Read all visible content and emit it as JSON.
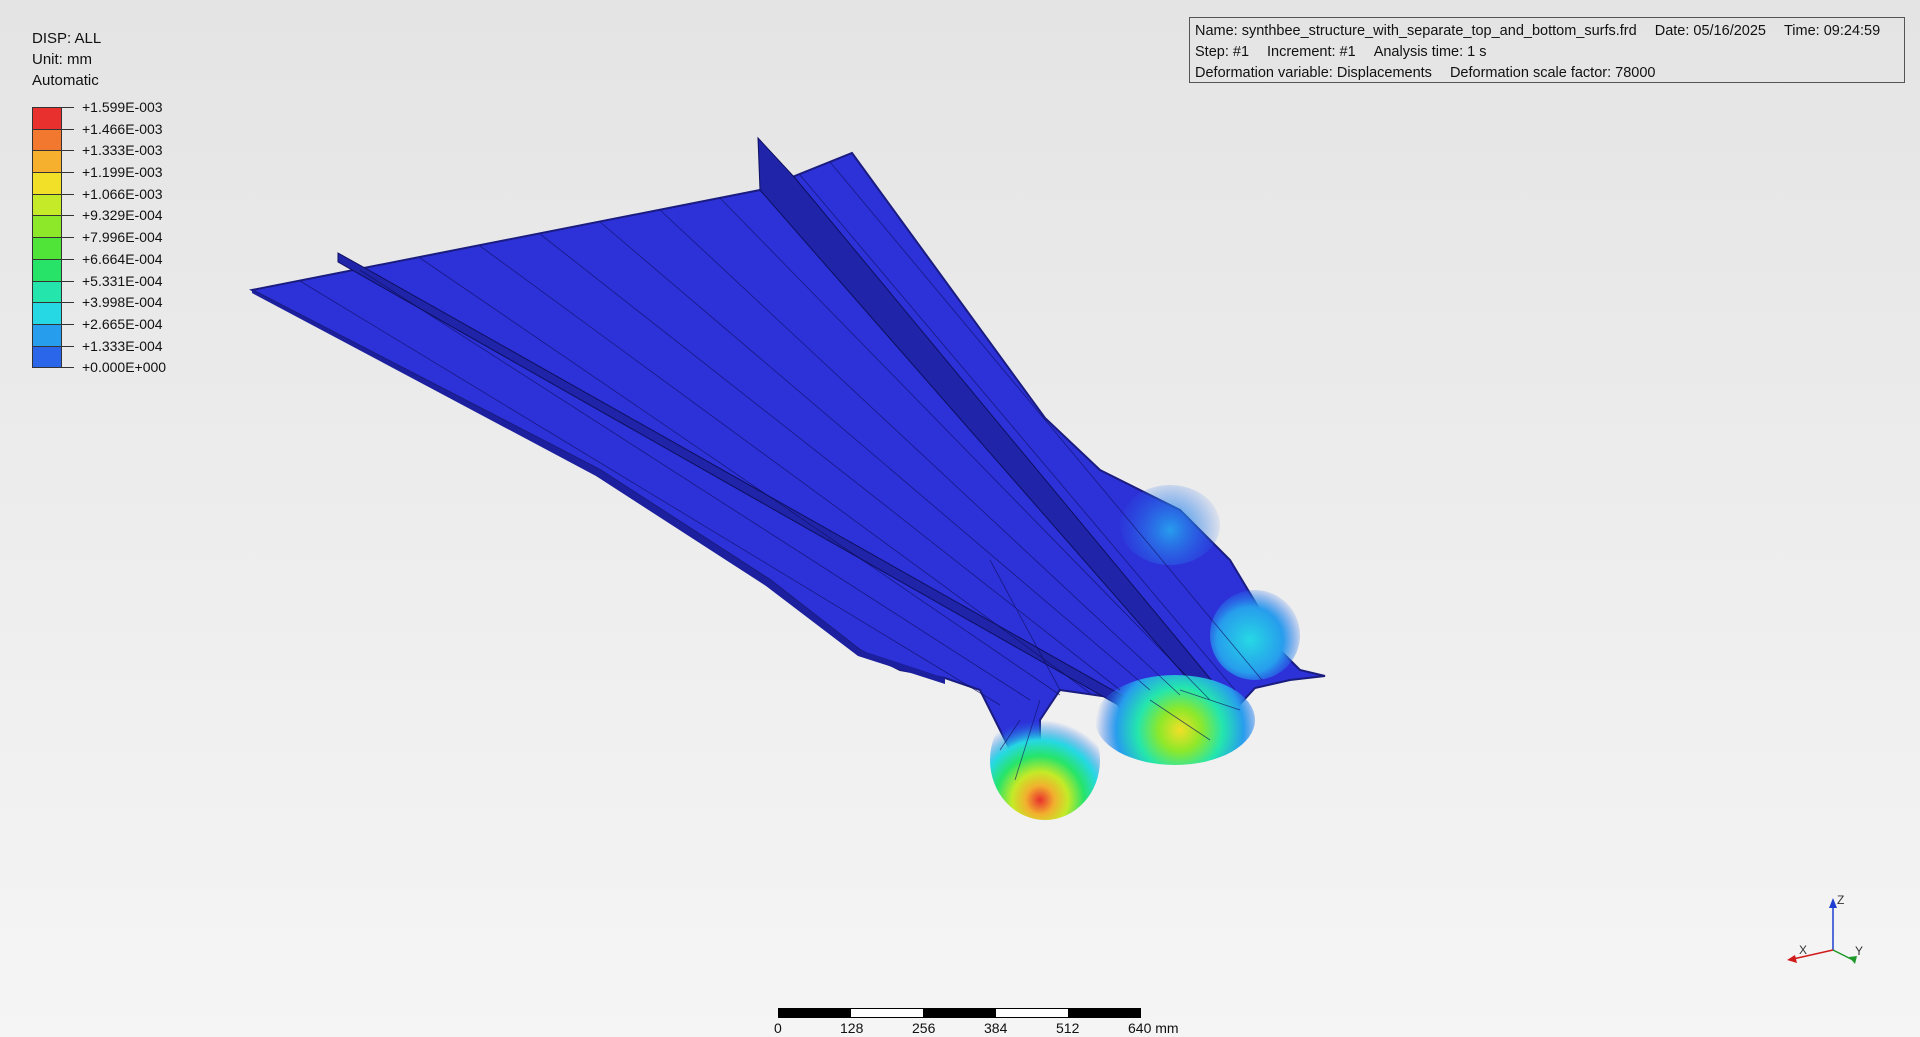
{
  "legend": {
    "variable": "DISP: ALL",
    "unit": "Unit: mm",
    "mode": "Automatic",
    "levels": [
      {
        "label": "+1.599E-003",
        "color": "#e8302e"
      },
      {
        "label": "+1.466E-003",
        "color": "#f2772f"
      },
      {
        "label": "+1.333E-003",
        "color": "#f7b02e"
      },
      {
        "label": "+1.199E-003",
        "color": "#f2df27"
      },
      {
        "label": "+1.066E-003",
        "color": "#c5ea27"
      },
      {
        "label": "+9.329E-004",
        "color": "#8de82a"
      },
      {
        "label": "+7.996E-004",
        "color": "#4fe437"
      },
      {
        "label": "+6.664E-004",
        "color": "#27e469"
      },
      {
        "label": "+5.331E-004",
        "color": "#24e6ad"
      },
      {
        "label": "+3.998E-004",
        "color": "#26d8e4"
      },
      {
        "label": "+2.665E-004",
        "color": "#279ded"
      },
      {
        "label": "+1.333E-004",
        "color": "#2a66ea"
      },
      {
        "label": "+0.000E+000",
        "color": "#2b35e0"
      }
    ]
  },
  "info": {
    "name": "Name: synthbee_structure_with_separate_top_and_bottom_surfs.frd",
    "date": "Date: 05/16/2025",
    "time": "Time: 09:24:59",
    "step": "Step: #1",
    "increment": "Increment: #1",
    "analysis_time": "Analysis time: 1 s",
    "deformation_variable": "Deformation variable: Displacements",
    "scale_factor": "Deformation scale factor: 78000"
  },
  "axes": {
    "x": "X",
    "y": "Y",
    "z": "Z",
    "x_color": "#d11a1a",
    "y_color": "#1f9a2a",
    "z_color": "#1f3fd0"
  },
  "scale_bar": {
    "ticks": [
      "0",
      "128",
      "256",
      "384",
      "512",
      "640 mm"
    ]
  },
  "colors": {
    "surface_base": "#2c31d8",
    "surface_dark": "#1c1f9e",
    "mesh_line": "#101060"
  }
}
